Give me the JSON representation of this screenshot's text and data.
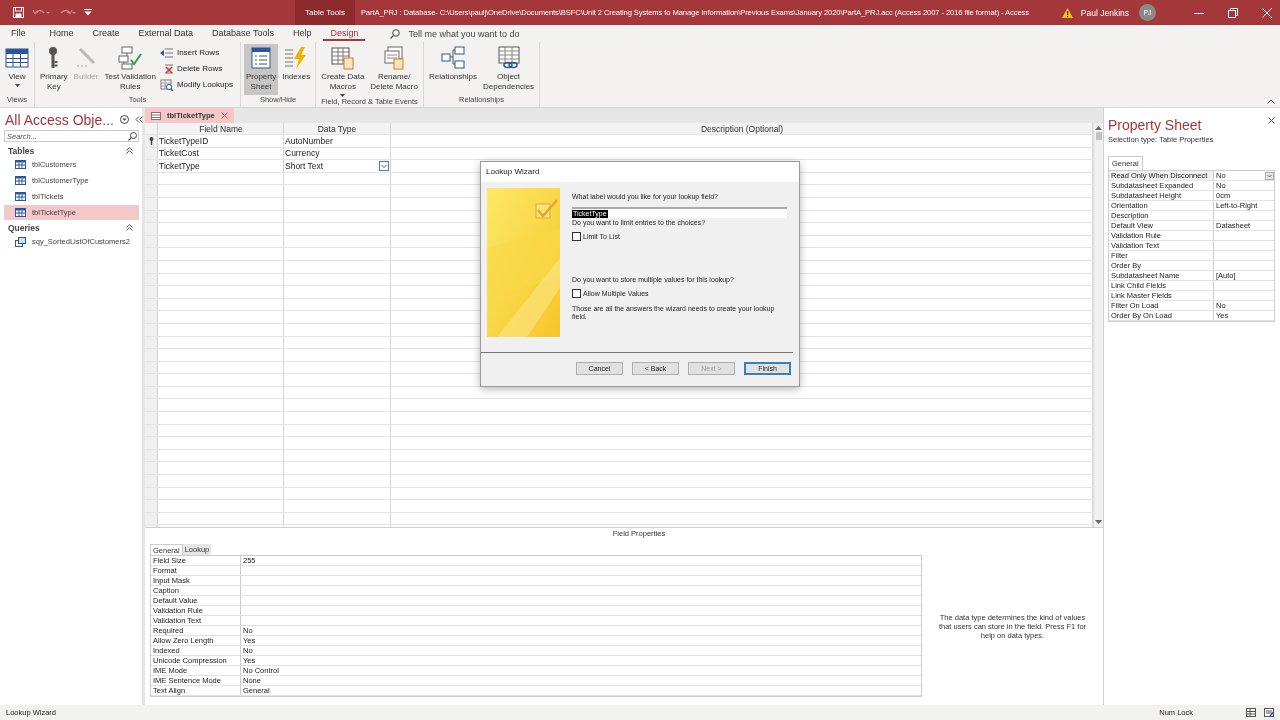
{
  "title_bar": {
    "quick_access": [
      {
        "kind": "save",
        "disabled": false
      },
      {
        "kind": "undo",
        "disabled": true
      },
      {
        "kind": "redo",
        "disabled": true
      },
      {
        "kind": "customize",
        "disabled": false
      }
    ],
    "context_tab": "Table Tools",
    "title": "PartA_PRJ : Database- C:\\Users\\paulj\\OneDrive\\Documents\\BSFC\\Unit 2 Creating Systems to Manage Information\\Previous Exams\\January 2020\\PartA_PRJ.acc (Access 2007 - 2016 file format)  -  Access",
    "user": "Paul Jenkins",
    "avatar": "PJ"
  },
  "ribbon": {
    "tabs": [
      {
        "label": "File",
        "selected": false
      },
      {
        "label": "Home",
        "selected": false
      },
      {
        "label": "Create",
        "selected": false
      },
      {
        "label": "External Data",
        "selected": false
      },
      {
        "label": "Database Tools",
        "selected": false
      },
      {
        "label": "Help",
        "selected": false
      },
      {
        "label": "Design",
        "selected": true
      }
    ],
    "search_placeholder": "Tell me what you want to do",
    "groups": [
      {
        "label": "Views",
        "buttons": [
          {
            "kind": "large",
            "label": "View",
            "menu": true,
            "disabled": false,
            "selected": false
          }
        ]
      },
      {
        "label": "Tools",
        "buttons": [
          {
            "kind": "large",
            "label": "Primary\nKey",
            "menu": false,
            "disabled": false,
            "selected": false
          },
          {
            "kind": "large",
            "label": "Builder",
            "menu": false,
            "disabled": true,
            "selected": false
          },
          {
            "kind": "large",
            "label": "Test Validation\nRules",
            "menu": false,
            "disabled": false,
            "selected": false
          },
          {
            "kind": "small",
            "label": "Insert Rows",
            "menu": false,
            "disabled": false,
            "selected": false
          },
          {
            "kind": "small",
            "label": "Delete Rows",
            "menu": false,
            "disabled": false,
            "selected": false
          },
          {
            "kind": "small",
            "label": "Modify Lookups",
            "menu": false,
            "disabled": false,
            "selected": false
          }
        ]
      },
      {
        "label": "Show/Hide",
        "buttons": [
          {
            "kind": "large",
            "label": "Property\nSheet",
            "menu": false,
            "disabled": false,
            "selected": true
          },
          {
            "kind": "large",
            "label": "Indexes",
            "menu": false,
            "disabled": false,
            "selected": false
          }
        ]
      },
      {
        "label": "Field, Record & Table Events",
        "buttons": [
          {
            "kind": "large",
            "label": "Create Data\nMacros",
            "menu": true,
            "disabled": false,
            "selected": false
          },
          {
            "kind": "large",
            "label": "Rename/\nDelete Macro",
            "menu": false,
            "disabled": false,
            "selected": false
          }
        ]
      },
      {
        "label": "Relationships",
        "buttons": [
          {
            "kind": "large",
            "label": "Relationships",
            "menu": false,
            "disabled": false,
            "selected": false
          },
          {
            "kind": "large",
            "label": "Object\nDependencies",
            "menu": false,
            "disabled": false,
            "selected": false
          }
        ]
      }
    ]
  },
  "navigation": {
    "title": "All Access Obje...",
    "search_placeholder": "Search...",
    "groups": [
      {
        "label": "Tables",
        "kind": "table",
        "items": [
          {
            "label": "tblCustomers",
            "selected": false
          },
          {
            "label": "tblCustomerType",
            "selected": false
          },
          {
            "label": "tblTickets",
            "selected": false
          },
          {
            "label": "tblTicketType",
            "selected": true
          }
        ]
      },
      {
        "label": "Queries",
        "kind": "query",
        "items": [
          {
            "label": "sqy_SortedListOfCustomers2",
            "selected": false
          }
        ]
      }
    ]
  },
  "document": {
    "tab": "tblTicketType",
    "columns": [
      "Field Name",
      "Data Type",
      "Description (Optional)"
    ],
    "rows": [
      {
        "field_name": "TicketTypeID",
        "data_type": "AutoNumber",
        "primary_key": true,
        "current": false
      },
      {
        "field_name": "TicketCost",
        "data_type": "Currency",
        "primary_key": false,
        "current": false
      },
      {
        "field_name": "TicketType",
        "data_type": "Short Text",
        "primary_key": false,
        "current": true
      }
    ],
    "field_properties": {
      "title": "Field Properties",
      "tabs": [
        {
          "label": "General",
          "selected": true
        },
        {
          "label": "Lookup",
          "selected": false
        }
      ],
      "rows": [
        {
          "name": "Field Size",
          "value": "255"
        },
        {
          "name": "Format"
        },
        {
          "name": "Input Mask"
        },
        {
          "name": "Caption"
        },
        {
          "name": "Default Value"
        },
        {
          "name": "Validation Rule"
        },
        {
          "name": "Validation Text"
        },
        {
          "name": "Required",
          "value": "No"
        },
        {
          "name": "Allow Zero Length",
          "value": "Yes"
        },
        {
          "name": "Indexed",
          "value": "No"
        },
        {
          "name": "Unicode Compression",
          "value": "Yes"
        },
        {
          "name": "IME Mode",
          "value": "No Control"
        },
        {
          "name": "IME Sentence Mode",
          "value": "None"
        },
        {
          "name": "Text Align",
          "value": "General"
        }
      ],
      "help": "The data type determines the kind of values that users can store in the field. Press F1 for help on data types."
    }
  },
  "property_sheet": {
    "title": "Property Sheet",
    "selection_type": "Selection type:  Table Properties",
    "tabs": [
      {
        "label": "General",
        "selected": true
      }
    ],
    "rows": [
      {
        "name": "Read Only When Disconnect",
        "value": "No",
        "current": true
      },
      {
        "name": "Subdatasheet Expanded",
        "value": "No",
        "current": false
      },
      {
        "name": "Subdatasheet Height",
        "value": "0cm",
        "current": false
      },
      {
        "name": "Orientation",
        "value": "Left-to-Right",
        "current": false
      },
      {
        "name": "Description",
        "current": false
      },
      {
        "name": "Default View",
        "value": "Datasheet",
        "current": false
      },
      {
        "name": "Validation Rule",
        "current": false
      },
      {
        "name": "Validation Text",
        "current": false
      },
      {
        "name": "Filter",
        "current": false
      },
      {
        "name": "Order By",
        "current": false
      },
      {
        "name": "Subdatasheet Name",
        "value": "[Auto]",
        "current": false
      },
      {
        "name": "Link Child Fields",
        "current": false
      },
      {
        "name": "Link Master Fields",
        "current": false
      },
      {
        "name": "Filter On Load",
        "value": "No",
        "current": false
      },
      {
        "name": "Order By On Load",
        "value": "Yes",
        "current": false
      }
    ]
  },
  "dialog": {
    "title": "Lookup Wizard",
    "label_question": "What label would you like for your lookup field?",
    "label_value": "TicketType",
    "limit_question": "Do you want to limit entries to the choices?",
    "limit_checkbox": {
      "label": "Limit To List",
      "checked": false
    },
    "multiple_question": "Do you want to store multiple values for this lookup?",
    "multiple_checkbox": {
      "label": "Allow Multiple Values",
      "checked": false
    },
    "note": "Those are all the answers the wizard needs to create your lookup field.",
    "buttons": [
      {
        "label": "Cancel",
        "disabled": false,
        "default": false
      },
      {
        "label": "< Back",
        "disabled": false,
        "default": false
      },
      {
        "label": "Next >",
        "disabled": true,
        "default": false
      },
      {
        "label": "Finish",
        "disabled": false,
        "default": true
      }
    ]
  },
  "status_bar": {
    "message": "Lookup Wizard",
    "indicator": "Num Lock"
  }
}
